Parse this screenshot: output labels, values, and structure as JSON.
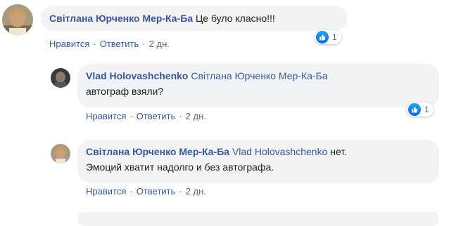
{
  "comments": [
    {
      "author": "Світлана Юрченко Мер-Ка-Ба",
      "mention": "",
      "text": "Це було класно!!!",
      "like_label": "Нравится",
      "reply_label": "Ответить",
      "time": "2 дн.",
      "reaction_count": "1",
      "reaction_icon": "like-icon"
    },
    {
      "author": "Vlad Holovashchenko",
      "mention": "Світлана Юрченко Мер-Ка-Ба",
      "text_line2": "автограф взяли?",
      "like_label": "Нравится",
      "reply_label": "Ответить",
      "time": "2 дн.",
      "reaction_count": "1",
      "reaction_icon": "like-icon"
    },
    {
      "author": "Світлана Юрченко Мер-Ка-Ба",
      "mention": "Vlad Holovashchenko",
      "text_line1": "нет.",
      "text_line2": "Эмоций хватит надолго и без автографа.",
      "like_label": "Нравится",
      "reply_label": "Ответить",
      "time": "2 дн."
    }
  ],
  "colors": {
    "link": "#385898",
    "bubble": "#f2f3f5",
    "meta": "#606770",
    "like_blue": "#1877f2"
  }
}
